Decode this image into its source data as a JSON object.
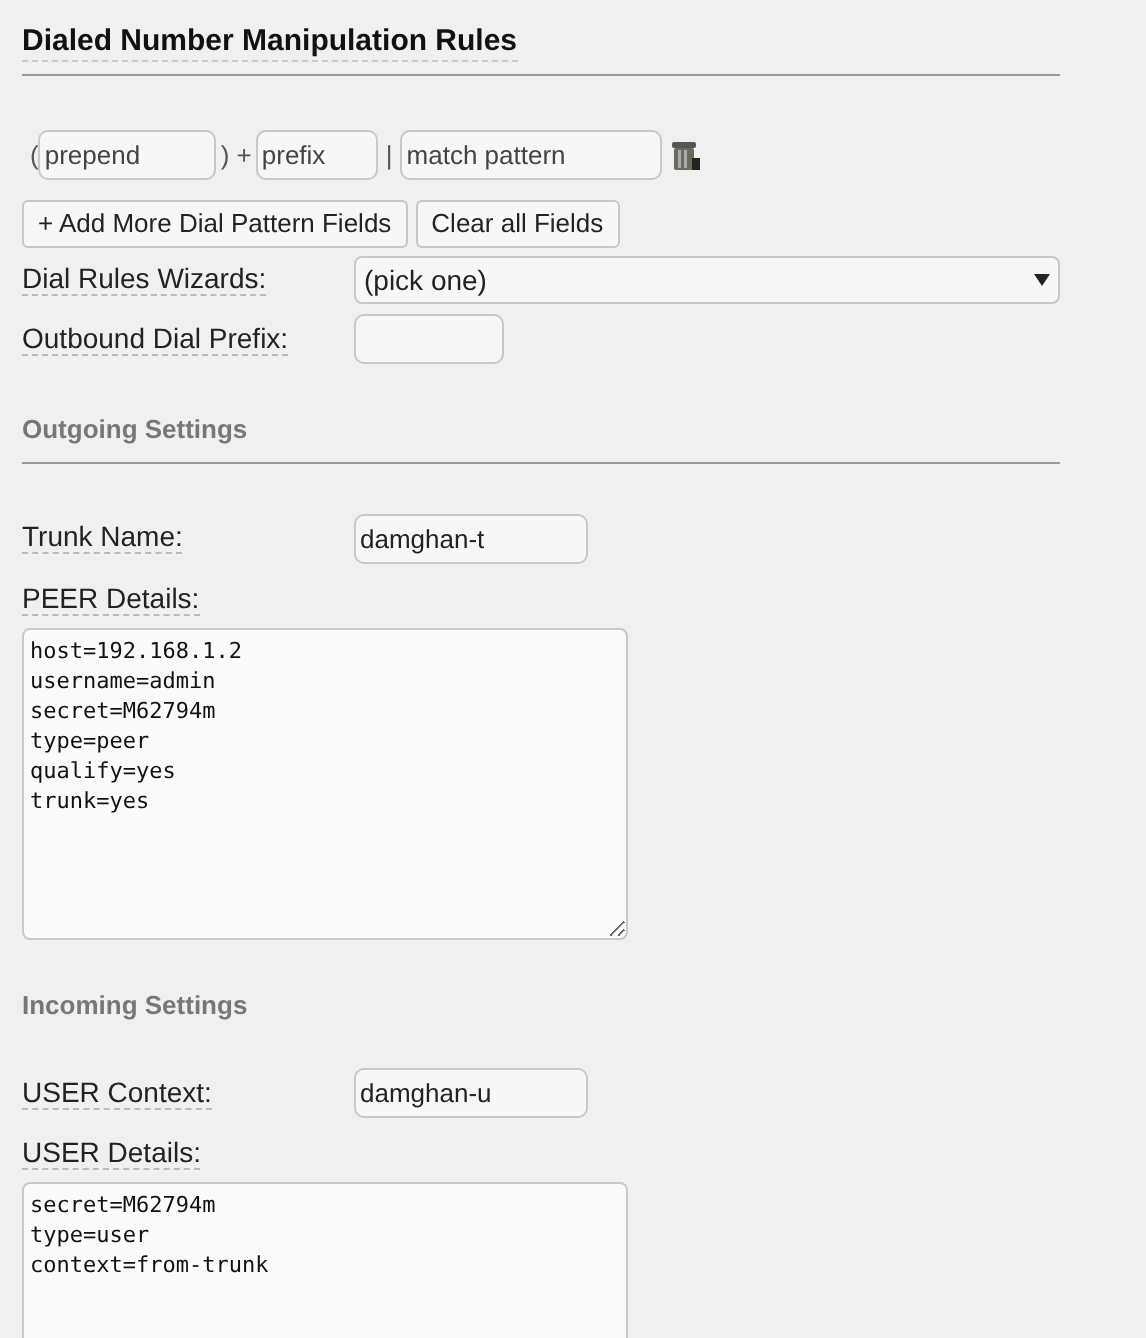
{
  "title": "Dialed Number Manipulation Rules",
  "dial_pattern": {
    "open_paren": "(",
    "prepend_placeholder": "prepend",
    "close_plus": ") +",
    "prefix_placeholder": "prefix",
    "bar": "|",
    "match_placeholder": "match pattern"
  },
  "buttons": [
    "+ Add More Dial Pattern Fields",
    "Clear all Fields"
  ],
  "wizards": {
    "label": "Dial Rules Wizards:",
    "value": "(pick one)"
  },
  "outbound_prefix": {
    "label": "Outbound Dial Prefix:"
  },
  "outgoing": {
    "heading": "Outgoing Settings",
    "trunk_label": "Trunk Name:",
    "trunk_value": "damghan-t",
    "details_label": "PEER Details:",
    "details": "host=192.168.1.2\nusername=admin\nsecret=M62794m\ntype=peer\nqualify=yes\ntrunk=yes"
  },
  "incoming": {
    "heading": "Incoming Settings",
    "context_label": "USER Context:",
    "context_value": "damghan-u",
    "details_label": "USER Details:",
    "details": "secret=M62794m\ntype=user\ncontext=from-trunk"
  }
}
